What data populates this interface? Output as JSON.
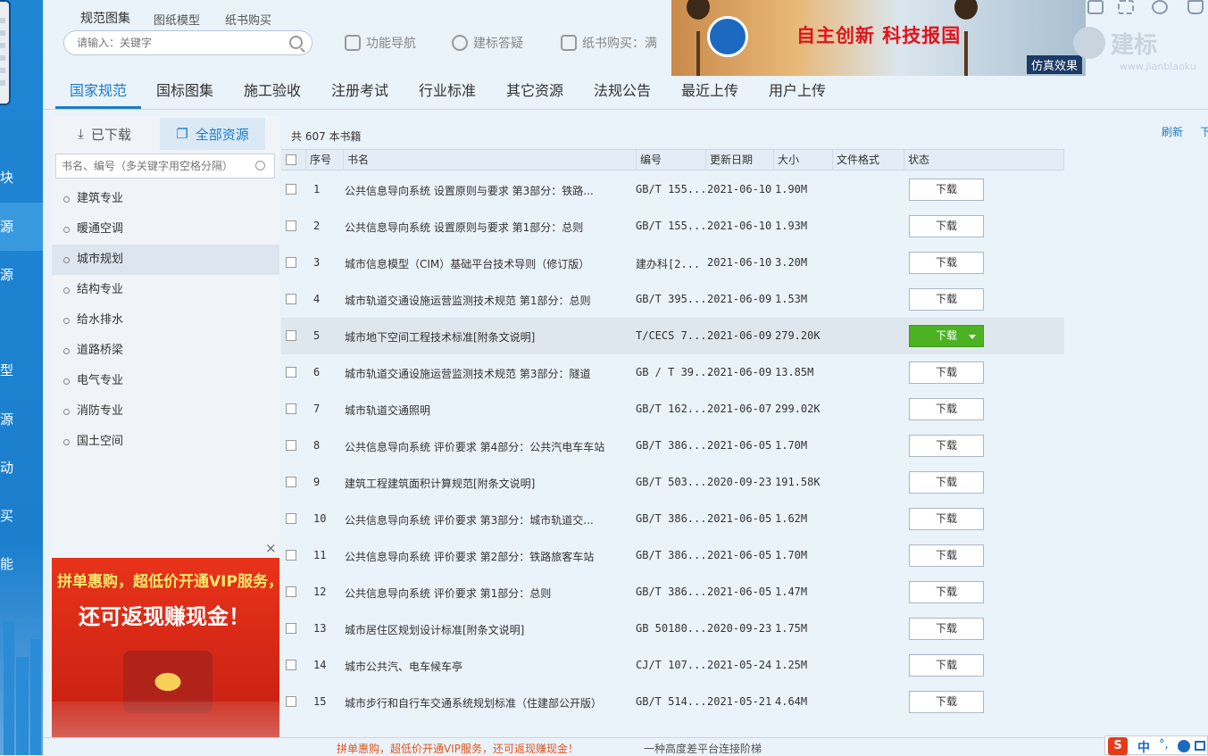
{
  "rail": {
    "items": [
      "块",
      "源",
      "源",
      "型",
      "源",
      "动",
      "买",
      "能"
    ]
  },
  "header": {
    "top_tabs": [
      "规范图集",
      "图纸模型",
      "纸书购买"
    ],
    "search_placeholder": "请输入：关键字",
    "links": [
      "功能导航",
      "建标答疑",
      "纸书购买：满"
    ],
    "ad": {
      "slogan": "自主创新 科技报国",
      "badge": "仿真效果"
    },
    "brand": "建标",
    "brand_url": "www.jianbiaoku"
  },
  "nav": {
    "items": [
      "国家规范",
      "国标图集",
      "施工验收",
      "注册考试",
      "行业标准",
      "其它资源",
      "法规公告",
      "最近上传",
      "用户上传"
    ]
  },
  "sidebar": {
    "tabs": [
      "已下载",
      "全部资源"
    ],
    "search_placeholder": "书名、编号（多关键字用空格分隔）",
    "categories": [
      "建筑专业",
      "暖通空调",
      "城市规划",
      "结构专业",
      "给水排水",
      "道路桥梁",
      "电气专业",
      "消防专业",
      "国土空间"
    ]
  },
  "promo": {
    "line1": "拼单惠购，超低价开通VIP服务，",
    "line2": "还可返现赚现金！",
    "close": "×"
  },
  "content": {
    "count": "共 607 本书籍",
    "refresh": "刷新",
    "download_top": "下",
    "columns": [
      "序号",
      "书名",
      "编号",
      "更新日期",
      "大小",
      "文件格式",
      "状态"
    ],
    "rows": [
      {
        "no": "1",
        "title": "公共信息导向系统 设置原则与要求 第3部分：铁路...",
        "code": "GB/T 155...",
        "date": "2021-06-10",
        "size": "1.90M",
        "action": "下载"
      },
      {
        "no": "2",
        "title": "公共信息导向系统 设置原则与要求 第1部分：总则",
        "code": "GB/T 155...",
        "date": "2021-06-10",
        "size": "1.93M",
        "action": "下载"
      },
      {
        "no": "3",
        "title": "城市信息模型（CIM）基础平台技术导则（修订版）",
        "code": "建办科[2...",
        "date": "2021-06-10",
        "size": "3.20M",
        "action": "下载"
      },
      {
        "no": "4",
        "title": "城市轨道交通设施运营监测技术规范 第1部分：总则",
        "code": "GB/T 395...",
        "date": "2021-06-09",
        "size": "1.53M",
        "action": "下载"
      },
      {
        "no": "5",
        "title": "城市地下空间工程技术标准[附条文说明]",
        "code": "T/CECS 7...",
        "date": "2021-06-09",
        "size": "279.20K",
        "action": "下载"
      },
      {
        "no": "6",
        "title": "城市轨道交通设施运营监测技术规范 第3部分：隧道",
        "code": "GB / T 39...",
        "date": "2021-06-09",
        "size": "13.85M",
        "action": "下载"
      },
      {
        "no": "7",
        "title": "城市轨道交通照明",
        "code": "GB/T 162...",
        "date": "2021-06-07",
        "size": "299.02K",
        "action": "下载"
      },
      {
        "no": "8",
        "title": "公共信息导向系统 评价要求 第4部分：公共汽电车车站",
        "code": "GB/T 386...",
        "date": "2021-06-05",
        "size": "1.70M",
        "action": "下载"
      },
      {
        "no": "9",
        "title": "建筑工程建筑面积计算规范[附条文说明]",
        "code": "GB/T 503...",
        "date": "2020-09-23",
        "size": "191.58K",
        "action": "下载"
      },
      {
        "no": "10",
        "title": "公共信息导向系统 评价要求 第3部分：城市轨道交...",
        "code": "GB/T 386...",
        "date": "2021-06-05",
        "size": "1.62M",
        "action": "下载"
      },
      {
        "no": "11",
        "title": "公共信息导向系统 评价要求 第2部分：铁路旅客车站",
        "code": "GB/T 386...",
        "date": "2021-06-05",
        "size": "1.70M",
        "action": "下载"
      },
      {
        "no": "12",
        "title": "公共信息导向系统 评价要求 第1部分：总则",
        "code": "GB/T 386...",
        "date": "2021-06-05",
        "size": "1.47M",
        "action": "下载"
      },
      {
        "no": "13",
        "title": "城市居住区规划设计标准[附条文说明]",
        "code": "GB 50180...",
        "date": "2020-09-23",
        "size": "1.75M",
        "action": "下载"
      },
      {
        "no": "14",
        "title": "城市公共汽、电车候车亭",
        "code": "CJ/T 107...",
        "date": "2021-05-24",
        "size": "1.25M",
        "action": "下载"
      },
      {
        "no": "15",
        "title": "城市步行和自行车交通系统规划标准（住建部公开版）",
        "code": "GB/T 514...",
        "date": "2021-05-21",
        "size": "4.64M",
        "action": "下载"
      }
    ]
  },
  "status_bar": {
    "promo_text": "拼单惠购，超低价开通VIP服务，还可返现赚现金！",
    "notice": "一种高度差平台连接阶梯"
  },
  "ime": {
    "logo": "S",
    "mode": "中",
    "punct": "°,"
  }
}
